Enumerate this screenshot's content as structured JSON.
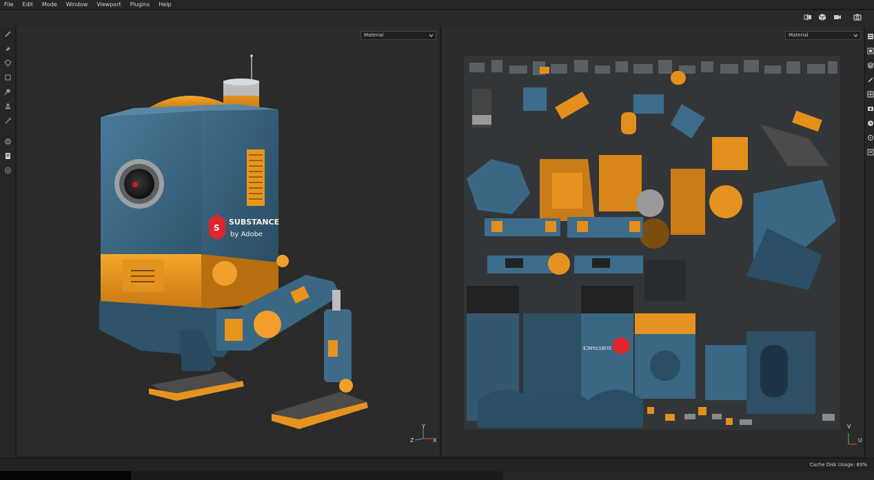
{
  "menu": [
    "File",
    "Edit",
    "Mode",
    "Window",
    "Viewport",
    "Plugins",
    "Help"
  ],
  "viewport3d": {
    "channel": "Material",
    "axes": {
      "y": "Y",
      "z": "Z",
      "x": "X"
    },
    "logo_text": "SUBSTANCE",
    "logo_sub": "by Adobe"
  },
  "viewport2d": {
    "channel": "Material",
    "axes": {
      "v": "V",
      "u": "U"
    }
  },
  "status": {
    "cache_label": "Cache Disk Usage:",
    "cache_value": "83%"
  },
  "left_tools": [
    "brush-icon",
    "eraser-icon",
    "projection-icon",
    "polygon-fill-icon",
    "smudge-icon",
    "clone-icon",
    "color-picker-icon",
    "settings-icon",
    "document-icon",
    "bake-icon"
  ],
  "right_tools": [
    "texture-set-list-icon",
    "texture-set-settings-icon",
    "layers-icon",
    "properties-icon",
    "display-settings-icon",
    "shader-settings-icon",
    "history-icon",
    "log-icon",
    "library-icon"
  ],
  "top_tools": [
    "split-view-icon",
    "cube-icon",
    "camera-icon",
    "screenshot-icon"
  ],
  "colors": {
    "accent_orange": "#e8951c",
    "robot_blue": "#3f6b89",
    "panel_bg": "#2b2b2b"
  }
}
